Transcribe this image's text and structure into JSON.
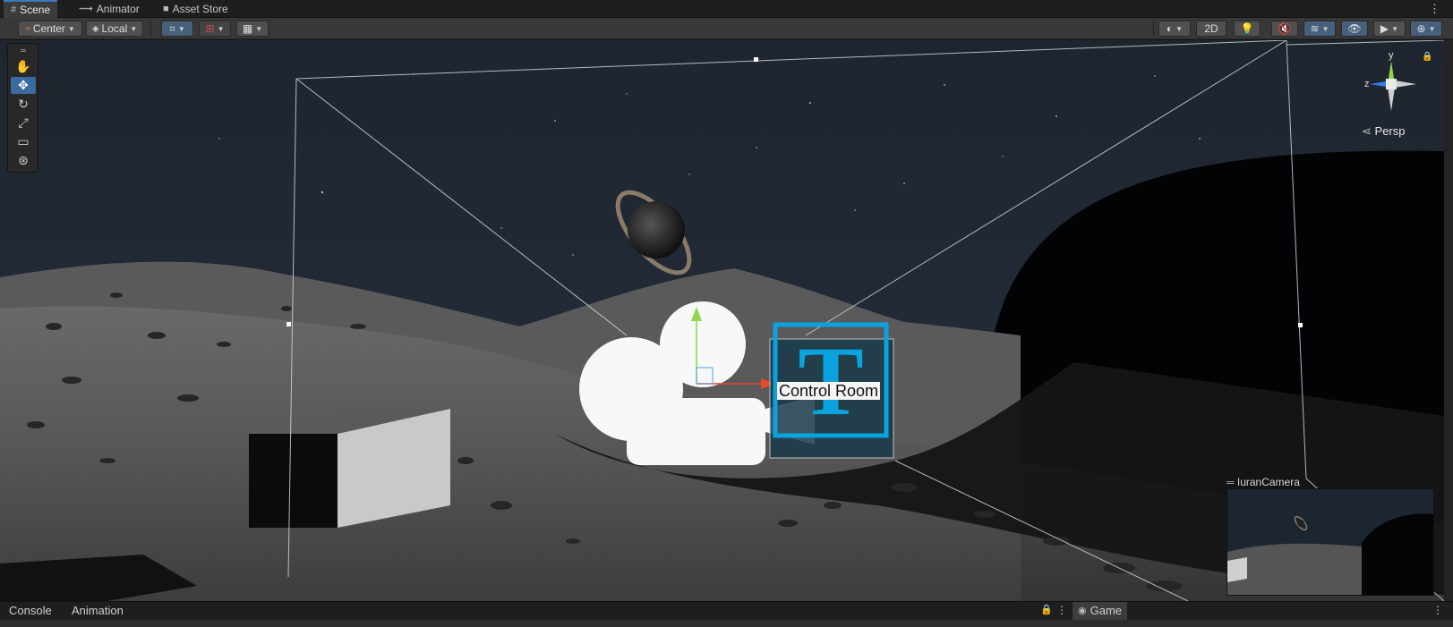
{
  "tabs_top": [
    {
      "label": "Scene",
      "icon": "grid-icon"
    },
    {
      "label": "Animator",
      "icon": "animator-icon"
    },
    {
      "label": "Asset Store",
      "icon": "bag-icon"
    }
  ],
  "toolbar": {
    "pivot_mode": "Center",
    "pivot_rotation": "Local",
    "mode_2d": "2D"
  },
  "tools": [
    "hand-tool",
    "move-tool",
    "rotate-tool",
    "scale-tool",
    "rect-tool",
    "transform-tool"
  ],
  "gizmo": {
    "axis_y": "y",
    "axis_z": "z",
    "projection": "Persp"
  },
  "scene": {
    "text_object": "Control Room",
    "text_icon_letter": "T"
  },
  "camera_preview": {
    "name": "IuranCamera"
  },
  "tabs_bottom": [
    {
      "label": "Console",
      "icon": "console-icon"
    },
    {
      "label": "Animation",
      "icon": "animation-icon"
    },
    {
      "label": "Game",
      "icon": "gamepad-icon"
    }
  ],
  "colors": {
    "accent": "#3a79bb",
    "text_box": "#0aa3e0",
    "x_axis": "#e8482b",
    "y_axis": "#8fd64a",
    "z_axis": "#3a7ae8"
  }
}
